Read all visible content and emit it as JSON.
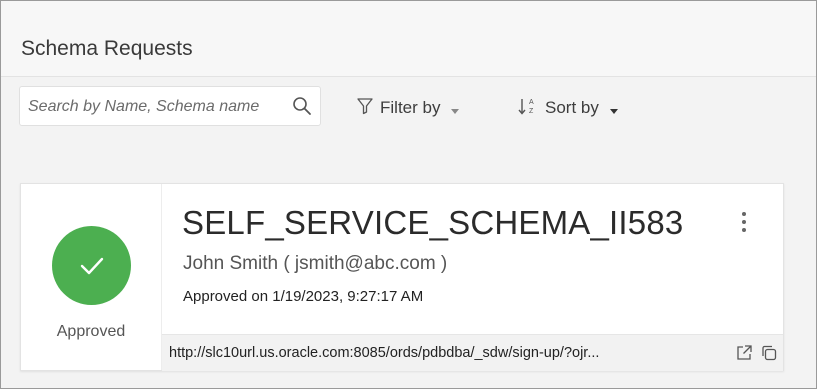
{
  "page": {
    "title": "Schema Requests"
  },
  "toolbar": {
    "search_placeholder": "Search by Name, Schema name",
    "search_value": "",
    "filter_label": "Filter by",
    "sort_label": "Sort by"
  },
  "card": {
    "status": "Approved",
    "status_color": "#4caf50",
    "schema_name": "SELF_SERVICE_SCHEMA_II583",
    "requester": "John Smith ( jsmith@abc.com )",
    "approved_on": "Approved on 1/19/2023, 9:27:17 AM",
    "url": "http://slc10url.us.oracle.com:8085/ords/pdbdba/_sdw/sign-up/?ojr..."
  },
  "icons": {
    "search": "search-icon",
    "filter": "filter-icon",
    "sort": "sort-icon",
    "status": "checkmark-icon",
    "menu": "kebab-menu-icon",
    "open": "open-external-icon",
    "copy": "copy-icon"
  }
}
